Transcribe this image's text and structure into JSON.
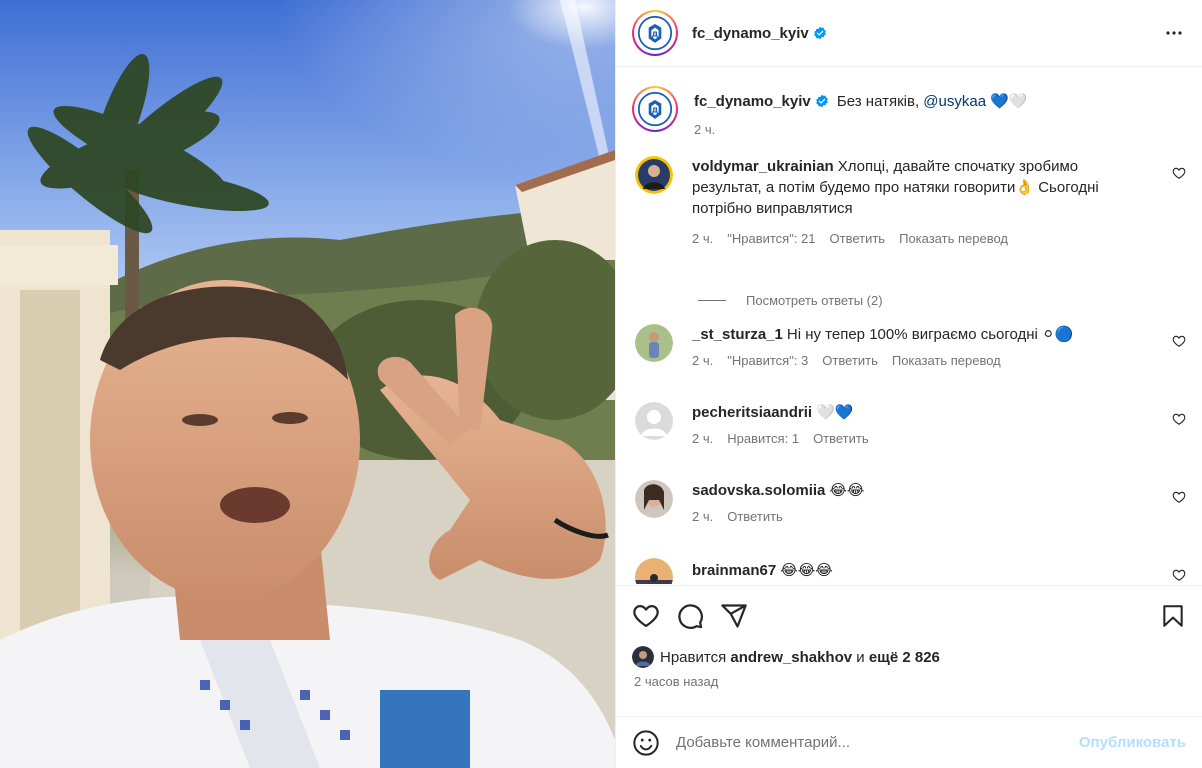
{
  "account": {
    "username": "fc_dynamo_kyiv",
    "verified": true
  },
  "header": {
    "more_icon": "more-horizontal-icon"
  },
  "caption": {
    "username": "fc_dynamo_kyiv",
    "text": "Без натяків, ",
    "mention": "@usykaa",
    "emoji": "💙🤍",
    "time": "2 ч."
  },
  "comments": [
    {
      "username": "voldymar_ukrainian",
      "text": "Хлопці, давайте спочатку зробимо результат, а потім будемо про натяки говорити👌 Сьогодні потрібно виправлятися",
      "time": "2 ч.",
      "likes": "\"Нравится\": 21",
      "reply": "Ответить",
      "translate": "Показать перевод",
      "view_replies": "Посмотреть ответы (2)"
    },
    {
      "username": "_st_sturza_1",
      "text": "Ні ну тепер 100% виграємо сьогодні ⚪🔵",
      "time": "2 ч.",
      "likes": "\"Нравится\": 3",
      "reply": "Ответить",
      "translate": "Показать перевод"
    },
    {
      "username": "pecheritsiaandrii",
      "text": "🤍💙",
      "time": "2 ч.",
      "likes": "Нравится: 1",
      "reply": "Ответить"
    },
    {
      "username": "sadovska.solomiia",
      "text": "😂😂",
      "time": "2 ч.",
      "reply": "Ответить"
    },
    {
      "username": "brainman67",
      "text": "😂😂😂"
    }
  ],
  "actions": {
    "like_icon": "heart-icon",
    "comment_icon": "comment-icon",
    "share_icon": "share-icon",
    "save_icon": "bookmark-icon"
  },
  "likes_summary": {
    "prefix": "Нравится ",
    "user": "andrew_shakhov",
    "middle": " и ",
    "rest": "ещё 2 826"
  },
  "time_ago": "2 часов назад",
  "add_comment": {
    "placeholder": "Добавьте комментарий...",
    "publish_label": "Опубликовать",
    "emoji_icon": "smiley-icon"
  },
  "colors": {
    "verified": "#0095f6",
    "publish_disabled": "#b2dffc",
    "mention": "#00376b"
  }
}
